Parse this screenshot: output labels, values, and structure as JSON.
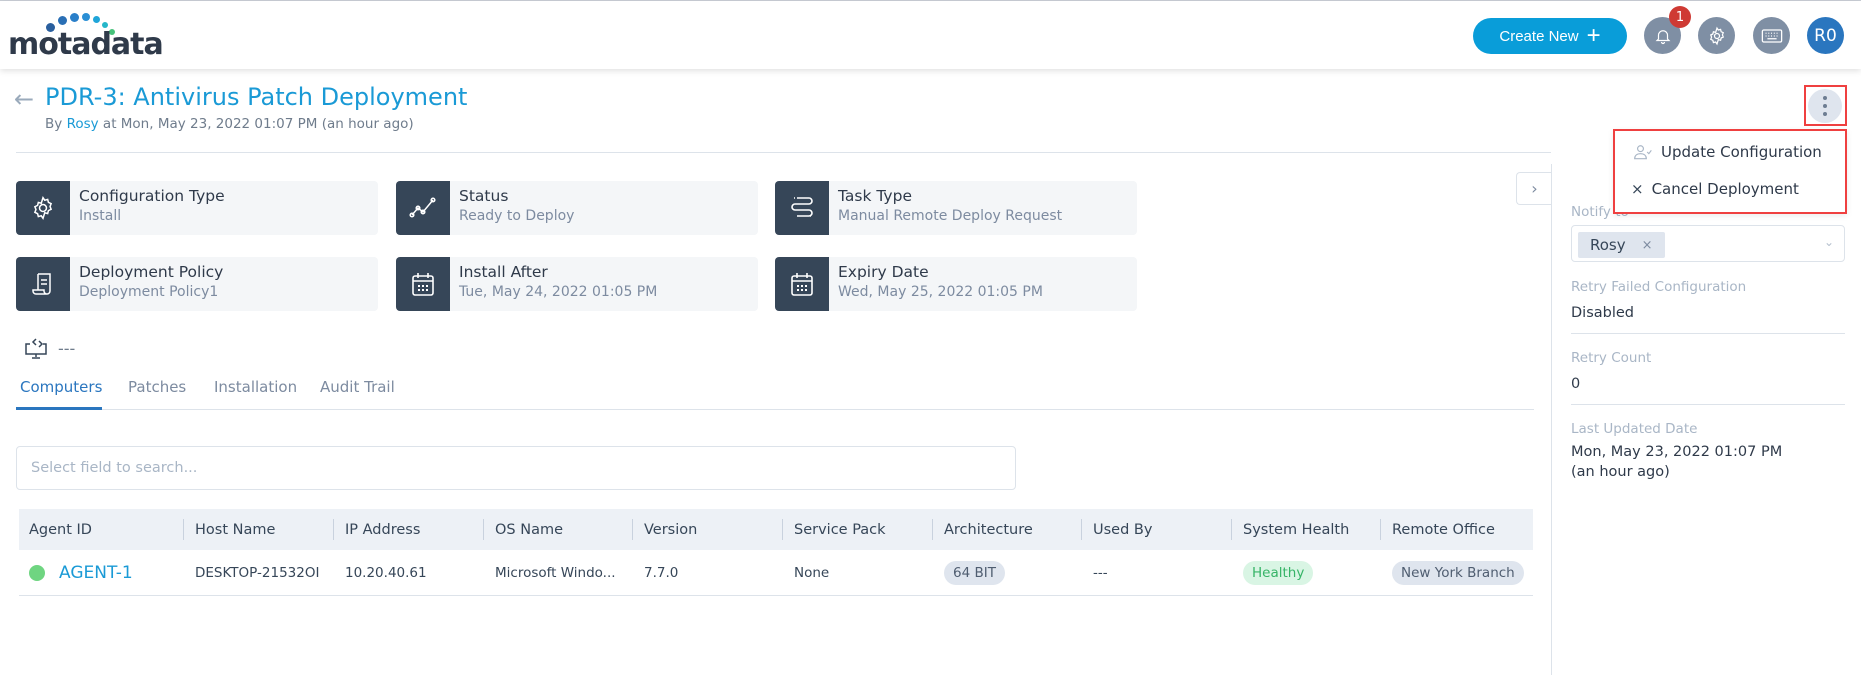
{
  "header": {
    "logo_text": "motadata",
    "create_new_label": "Create New",
    "notification_count": "1",
    "avatar_initials": "R0",
    "icons": [
      "bell-icon",
      "gear-icon",
      "keyboard-icon"
    ]
  },
  "page": {
    "back_icon": "arrow-left-icon",
    "title": "PDR-3: Antivirus Patch Deployment",
    "subtitle_prefix": "By",
    "subtitle_user": "Rosy",
    "subtitle_suffix": "at Mon, May 23, 2022 01:07 PM (an hour ago)"
  },
  "more_menu": {
    "items": [
      {
        "label": "Update Configuration",
        "icon": "user-check-icon"
      },
      {
        "label": "Cancel Deployment",
        "icon": "close-icon"
      }
    ]
  },
  "info_cards": [
    {
      "label": "Configuration Type",
      "value": "Install",
      "icon": "gear-icon"
    },
    {
      "label": "Status",
      "value": "Ready to Deploy",
      "icon": "chart-line-icon"
    },
    {
      "label": "Task Type",
      "value": "Manual Remote Deploy Request",
      "icon": "task-list-icon"
    },
    {
      "label": "Deployment Policy",
      "value": "Deployment Policy1",
      "icon": "scroll-icon"
    },
    {
      "label": "Install After",
      "value": "Tue, May 24, 2022 01:05 PM",
      "icon": "calendar-icon"
    },
    {
      "label": "Expiry Date",
      "value": "Wed, May 25, 2022 01:05 PM",
      "icon": "calendar-icon"
    }
  ],
  "agent_info": {
    "icon": "remote-desktop-icon",
    "value": "---"
  },
  "tabs": [
    {
      "label": "Computers",
      "active": true
    },
    {
      "label": "Patches",
      "active": false
    },
    {
      "label": "Installation",
      "active": false
    },
    {
      "label": "Audit Trail",
      "active": false
    }
  ],
  "search": {
    "placeholder": "Select field to search...",
    "value": ""
  },
  "table": {
    "columns": [
      "Agent ID",
      "Host Name",
      "IP Address",
      "OS Name",
      "Version",
      "Service Pack",
      "Architecture",
      "Used By",
      "System Health",
      "Remote Office"
    ],
    "rows": [
      {
        "status_color": "#6fd581",
        "agent_id": "AGENT-1",
        "host_name": "DESKTOP-21532OI",
        "ip_address": "10.20.40.61",
        "os_name": "Microsoft Windo...",
        "version": "7.7.0",
        "service_pack": "None",
        "architecture": "64 BIT",
        "used_by": "---",
        "system_health": "Healthy",
        "remote_office": "New York Branch"
      }
    ]
  },
  "right_panel": {
    "notify_label": "Notify to",
    "notify_chip": "Rosy",
    "retry_failed_label": "Retry Failed Configuration",
    "retry_failed_value": "Disabled",
    "retry_count_label": "Retry Count",
    "retry_count_value": "0",
    "last_updated_label": "Last Updated Date",
    "last_updated_value": "Mon, May 23, 2022 01:07 PM",
    "last_updated_relative": "(an hour ago)"
  },
  "colors": {
    "accent": "#1a9ad6",
    "primary_button": "#099dd9",
    "card_icon_bg": "#364658",
    "badge": "#cf3a34",
    "healthy": "#36b467",
    "highlight_box": "#ef4040"
  }
}
